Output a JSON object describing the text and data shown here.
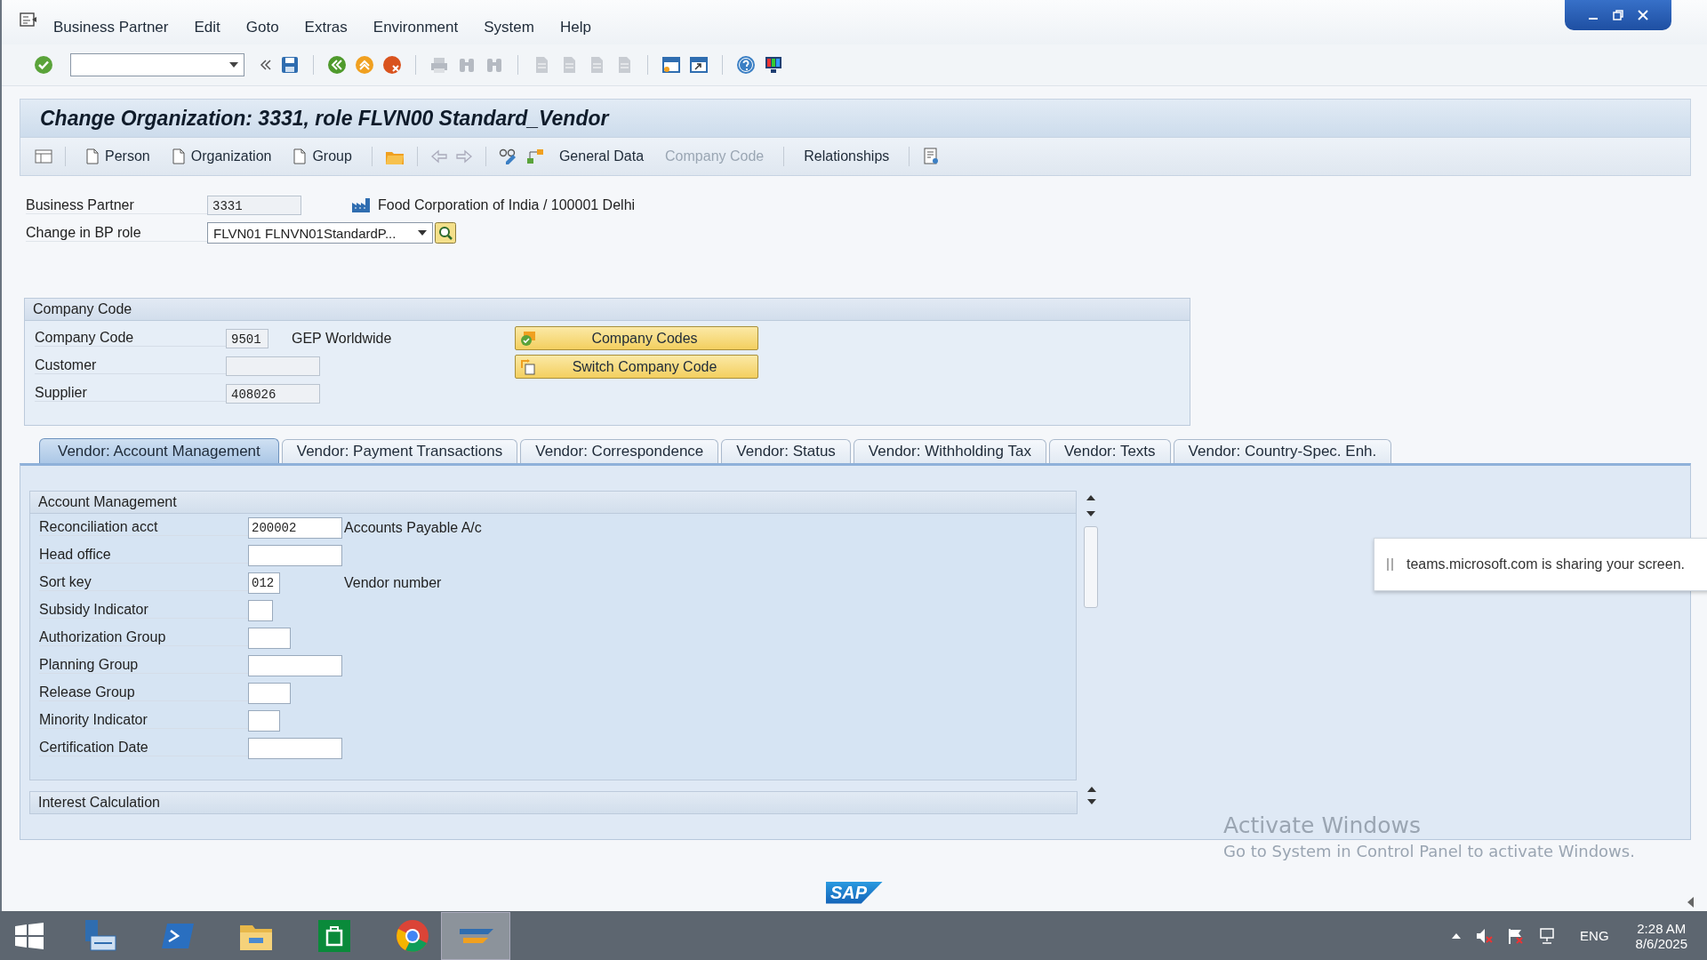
{
  "menu_bar": {
    "items": [
      "Business Partner",
      "Edit",
      "Goto",
      "Extras",
      "Environment",
      "System",
      "Help"
    ]
  },
  "title": "Change Organization: 3331, role FLVN00 Standard_Vendor",
  "app_toolbar": {
    "items": [
      {
        "label": "Person",
        "kind": "new",
        "disabled": false
      },
      {
        "label": "Organization",
        "kind": "new",
        "disabled": false
      },
      {
        "label": "Group",
        "kind": "new",
        "disabled": false
      },
      {
        "label": "General Data",
        "kind": "text",
        "disabled": false
      },
      {
        "label": "Company Code",
        "kind": "text",
        "disabled": true
      },
      {
        "label": "Relationships",
        "kind": "text",
        "disabled": false
      }
    ]
  },
  "header_fields": [
    {
      "label": "Business Partner",
      "value": "3331",
      "kind": "readonly",
      "description": "Food Corporation of India / 100001 Delhi"
    },
    {
      "label": "Change in BP role",
      "value": "FLVN01 FLNVN01StandardP...",
      "kind": "dropdown"
    }
  ],
  "company_code": {
    "title": "Company Code",
    "fields": [
      {
        "label": "Company Code",
        "value": "9501",
        "description": "GEP Worldwide"
      },
      {
        "label": "Customer"
      },
      {
        "label": "Supplier",
        "value": "408026"
      }
    ],
    "buttons": [
      {
        "label": "Company Codes",
        "kind": "check"
      },
      {
        "label": "Switch Company Code",
        "kind": "switch"
      }
    ]
  },
  "tabs": [
    {
      "label": "Vendor: Account Management",
      "selected": true
    },
    {
      "label": "Vendor: Payment Transactions",
      "selected": false
    },
    {
      "label": "Vendor: Correspondence",
      "selected": false
    },
    {
      "label": "Vendor: Status",
      "selected": false
    },
    {
      "label": "Vendor: Withholding Tax",
      "selected": false
    },
    {
      "label": "Vendor: Texts",
      "selected": false
    },
    {
      "label": "Vendor: Country-Spec. Enh.",
      "selected": false
    }
  ],
  "account_management": {
    "title": "Account Management",
    "fields": [
      {
        "label": "Reconciliation acct",
        "value": "200002",
        "description": "Accounts Payable A/c"
      },
      {
        "label": "Head office"
      },
      {
        "label": "Sort key",
        "value": "012",
        "description": "Vendor number"
      },
      {
        "label": "Subsidy Indicator"
      },
      {
        "label": "Authorization Group"
      },
      {
        "label": "Planning Group"
      },
      {
        "label": "Release Group"
      },
      {
        "label": "Minority Indicator"
      },
      {
        "label": "Certification Date"
      }
    ]
  },
  "collapsed_sections": [
    {
      "title": "Interest Calculation"
    }
  ],
  "logo": "SAP",
  "notification": {
    "text": "teams.microsoft.com is sharing your screen."
  },
  "activation_notice": {
    "title": "Activate Windows",
    "text": "Go to System in Control Panel to activate Windows."
  },
  "taskbar": {
    "language": "ENG",
    "time": "2:28 AM",
    "date": "8/6/2025"
  }
}
